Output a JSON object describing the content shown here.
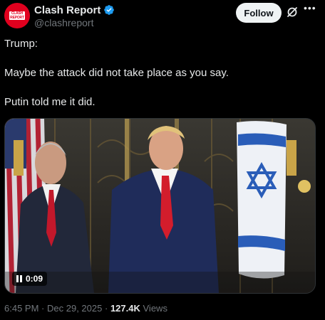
{
  "author": {
    "display_name": "Clash Report",
    "handle": "@clashreport",
    "avatar_logo_text": "CLASH\nREPORT",
    "avatar_color": "#e1001e",
    "verified": true,
    "verified_color": "#1d9bf0"
  },
  "actions": {
    "follow_label": "Follow",
    "grok_icon": "grok-icon",
    "more_icon": "more-icon"
  },
  "post": {
    "paragraphs": [
      "Trump:",
      "Maybe the attack did not take place as you say.",
      "Putin told me it did."
    ]
  },
  "media": {
    "type": "video",
    "duration": "0:09",
    "state_icon": "pause-icon"
  },
  "meta": {
    "time": "6:45 PM",
    "separator": "·",
    "date": "Dec 29, 2025",
    "views_count": "127.4K",
    "views_label": "Views"
  }
}
